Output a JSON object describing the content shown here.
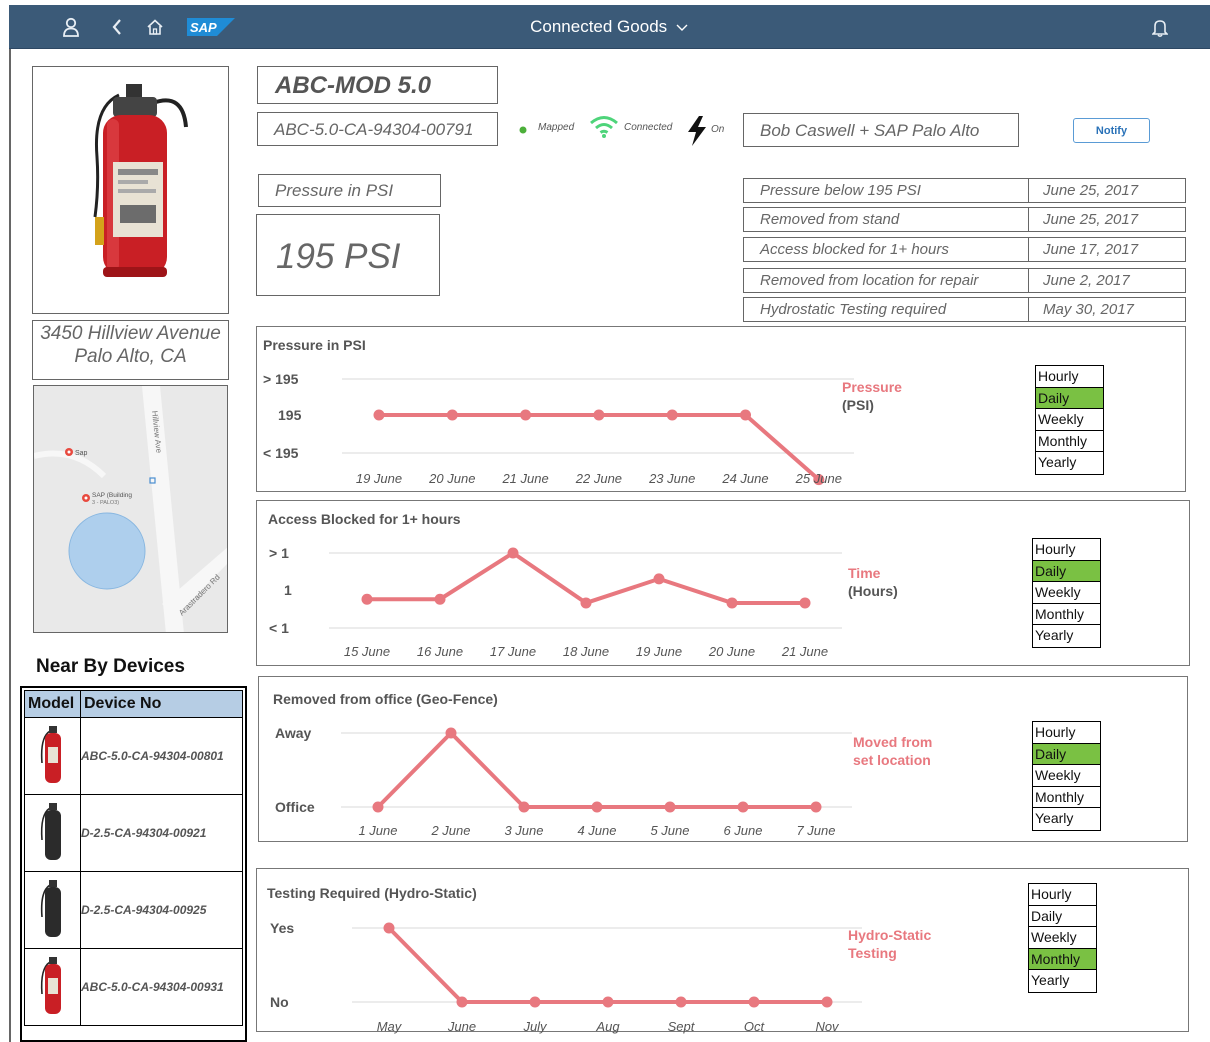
{
  "app": {
    "title": "Connected Goods",
    "logo_text": "SAP"
  },
  "device": {
    "model": "ABC-MOD 5.0",
    "id": "ABC-5.0-CA-94304-00791",
    "status_mapped": "Mapped",
    "status_connected": "Connected",
    "status_power": "On",
    "owner": "Bob Caswell + SAP Palo Alto",
    "notify_label": "Notify",
    "pressure_label": "Pressure in PSI",
    "pressure_value": "195 PSI",
    "address_line1": "3450 Hillview Avenue",
    "address_line2": "Palo Alto, CA"
  },
  "map": {
    "street1": "Hillview Ave",
    "street2": "Arastradero Rd",
    "poi1": "Sap",
    "poi2": "SAP (Building",
    "poi2_sub": "3 - PALO3)"
  },
  "events": [
    {
      "name": "Pressure below 195 PSI",
      "date": "June 25, 2017"
    },
    {
      "name": "Removed from stand",
      "date": "June 25, 2017"
    },
    {
      "name": "Access blocked for 1+ hours",
      "date": "June 17, 2017"
    },
    {
      "name": "Removed from location for repair",
      "date": "June 2, 2017"
    },
    {
      "name": "Hydrostatic Testing required",
      "date": "May 30, 2017"
    }
  ],
  "nearby": {
    "title": "Near By Devices",
    "col_model": "Model",
    "col_device": "Device No",
    "rows": [
      {
        "device": "ABC-5.0-CA-94304-00801",
        "color": "red"
      },
      {
        "device": "D-2.5-CA-94304-00921",
        "color": "black"
      },
      {
        "device": "D-2.5-CA-94304-00925",
        "color": "black"
      },
      {
        "device": "ABC-5.0-CA-94304-00931",
        "color": "red"
      }
    ]
  },
  "period_options": [
    "Hourly",
    "Daily",
    "Weekly",
    "Monthly",
    "Yearly"
  ],
  "chart_data": [
    {
      "type": "line",
      "title": "Pressure in PSI",
      "legend": [
        "Pressure",
        "(PSI)"
      ],
      "y_levels": [
        "> 195",
        "195",
        "< 195"
      ],
      "categories": [
        "19 June",
        "20 June",
        "21 June",
        "22 June",
        "23 June",
        "24 June",
        "25 June"
      ],
      "values": [
        1,
        1,
        1,
        1,
        1,
        1,
        0.15
      ],
      "series_color": "#e8787f",
      "selected_period": "Daily"
    },
    {
      "type": "line",
      "title": "Access Blocked for 1+ hours",
      "legend": [
        "Time",
        "(Hours)"
      ],
      "y_levels": [
        "> 1",
        "1",
        "< 1"
      ],
      "categories": [
        "15 June",
        "16 June",
        "17 June",
        "18 June",
        "19 June",
        "20 June",
        "21 June"
      ],
      "values": [
        0.75,
        0.75,
        2.0,
        0.65,
        1.3,
        0.65,
        0.65
      ],
      "series_color": "#e8787f",
      "selected_period": "Daily"
    },
    {
      "type": "line",
      "title": "Removed from office (Geo-Fence)",
      "legend": [
        "Moved from",
        "set location"
      ],
      "y_levels": [
        "Away",
        "Office"
      ],
      "categories": [
        "1 June",
        "2 June",
        "3 June",
        "4 June",
        "5 June",
        "6 June",
        "7 June"
      ],
      "values": [
        0,
        1,
        0,
        0,
        0,
        0,
        0
      ],
      "series_color": "#e8787f",
      "selected_period": "Daily"
    },
    {
      "type": "line",
      "title": "Testing Required (Hydro-Static)",
      "legend": [
        "Hydro-Static",
        "Testing"
      ],
      "y_levels": [
        "Yes",
        "No"
      ],
      "categories": [
        "May",
        "June",
        "July",
        "Aug",
        "Sept",
        "Oct",
        "Nov"
      ],
      "values": [
        1,
        0,
        0,
        0,
        0,
        0,
        0
      ],
      "series_color": "#e8787f",
      "selected_period": "Monthly"
    }
  ]
}
